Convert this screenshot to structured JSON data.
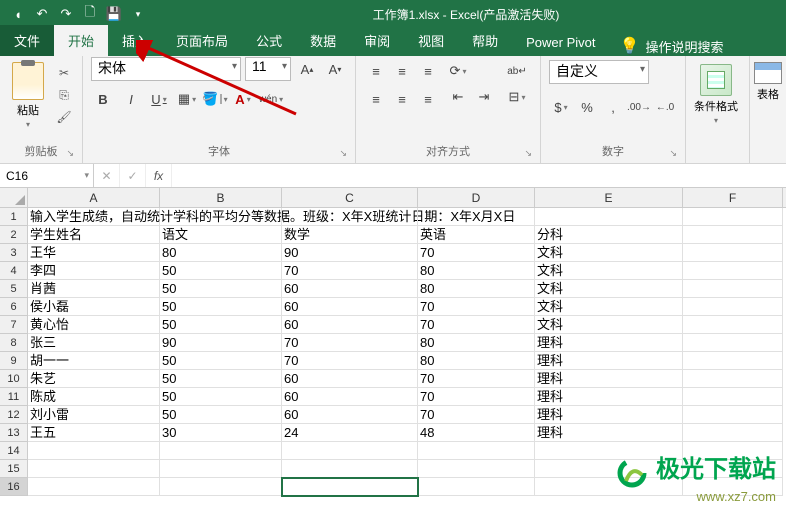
{
  "app": {
    "title": "工作簿1.xlsx - Excel(产品激活失败)"
  },
  "tabs": {
    "file": "文件",
    "home": "开始",
    "insert": "插入",
    "layout": "页面布局",
    "formulas": "公式",
    "data": "数据",
    "review": "审阅",
    "view": "视图",
    "help": "帮助",
    "powerpivot": "Power Pivot",
    "tellme": "操作说明搜索"
  },
  "ribbon": {
    "clipboard": {
      "label": "剪贴板",
      "paste": "粘贴"
    },
    "font": {
      "label": "字体",
      "name": "宋体",
      "size": "11",
      "wen": "wén"
    },
    "alignment": {
      "label": "对齐方式"
    },
    "number": {
      "label": "数字",
      "format": "自定义"
    },
    "cf": "条件格式",
    "tablefmt": "表格"
  },
  "namebox": "C16",
  "columns": [
    "A",
    "B",
    "C",
    "D",
    "E",
    "F"
  ],
  "rows": [
    {
      "n": 1,
      "cells": [
        "输入学生成绩，自动统计学科的平均分等数据。班级：X年X班统计日期：X年X月X日",
        "",
        "",
        "",
        "",
        ""
      ]
    },
    {
      "n": 2,
      "cells": [
        "学生姓名",
        "语文",
        "数学",
        "英语",
        "分科",
        ""
      ]
    },
    {
      "n": 3,
      "cells": [
        "王华",
        "80",
        "90",
        "70",
        "文科",
        ""
      ]
    },
    {
      "n": 4,
      "cells": [
        "李四",
        "50",
        "70",
        "80",
        "文科",
        ""
      ]
    },
    {
      "n": 5,
      "cells": [
        "肖茜",
        "50",
        "60",
        "80",
        "文科",
        ""
      ]
    },
    {
      "n": 6,
      "cells": [
        "侯小磊",
        "50",
        "60",
        "70",
        "文科",
        ""
      ]
    },
    {
      "n": 7,
      "cells": [
        "黄心怡",
        "50",
        "60",
        "70",
        "文科",
        ""
      ]
    },
    {
      "n": 8,
      "cells": [
        "张三",
        "90",
        "70",
        "80",
        "理科",
        ""
      ]
    },
    {
      "n": 9,
      "cells": [
        "胡一一",
        "50",
        "70",
        "80",
        "理科",
        ""
      ]
    },
    {
      "n": 10,
      "cells": [
        "朱艺",
        "50",
        "60",
        "70",
        "理科",
        ""
      ]
    },
    {
      "n": 11,
      "cells": [
        "陈成",
        "50",
        "60",
        "70",
        "理科",
        ""
      ]
    },
    {
      "n": 12,
      "cells": [
        "刘小雷",
        "50",
        "60",
        "70",
        "理科",
        ""
      ]
    },
    {
      "n": 13,
      "cells": [
        "王五",
        "30",
        "24",
        "48",
        "理科",
        ""
      ]
    },
    {
      "n": 14,
      "cells": [
        "",
        "",
        "",
        "",
        "",
        ""
      ]
    },
    {
      "n": 15,
      "cells": [
        "",
        "",
        "",
        "",
        "",
        ""
      ]
    },
    {
      "n": 16,
      "cells": [
        "",
        "",
        "",
        "",
        "",
        ""
      ]
    }
  ],
  "selected": {
    "row": 16,
    "col": "C"
  },
  "watermark": {
    "main": "极光下载站",
    "sub": "www.xz7.com"
  }
}
